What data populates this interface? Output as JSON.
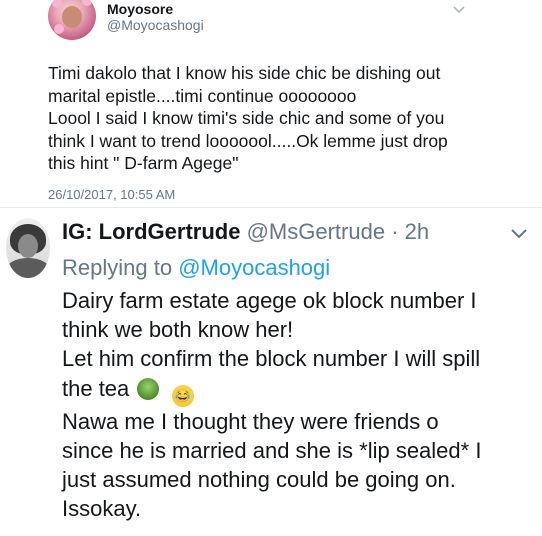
{
  "tweet1": {
    "display_name": "Moyosore",
    "handle": "@Moyocashogi",
    "lines": [
      "Timi dakolo that I know his side chic be dishing out",
      "marital epistle....timi continue oooooooo",
      "Loool I said I know timi's side chic and some of you",
      "think I want to trend looooool.....Ok lemme just drop",
      "this hint \" D-farm Agege\""
    ],
    "timestamp": "26/10/2017, 10:55 AM",
    "caret_icon": "chevron-down-icon"
  },
  "tweet2": {
    "display_name": "IG: LordGertrude",
    "handle": "@MsGertrude",
    "separator": "·",
    "age": "2h",
    "replying_prefix": "Replying to",
    "replying_to": "@Moyocashogi",
    "lines": [
      "Dairy farm estate agege ok block number I",
      "think we both know her!",
      "Let him confirm the block number I will spill",
      "the tea",
      "Nawa me I thought they were friends o",
      "since he is married and she is *lip sealed* I",
      "just assumed nothing could be going on.",
      "Issokay."
    ],
    "emojis": [
      "tea-emoji",
      "laughing-emoji"
    ],
    "caret_icon": "chevron-down-icon"
  },
  "colors": {
    "text": "#14171a",
    "secondary": "#657786",
    "link": "#1da1f2",
    "divider": "#e6ecf0"
  }
}
